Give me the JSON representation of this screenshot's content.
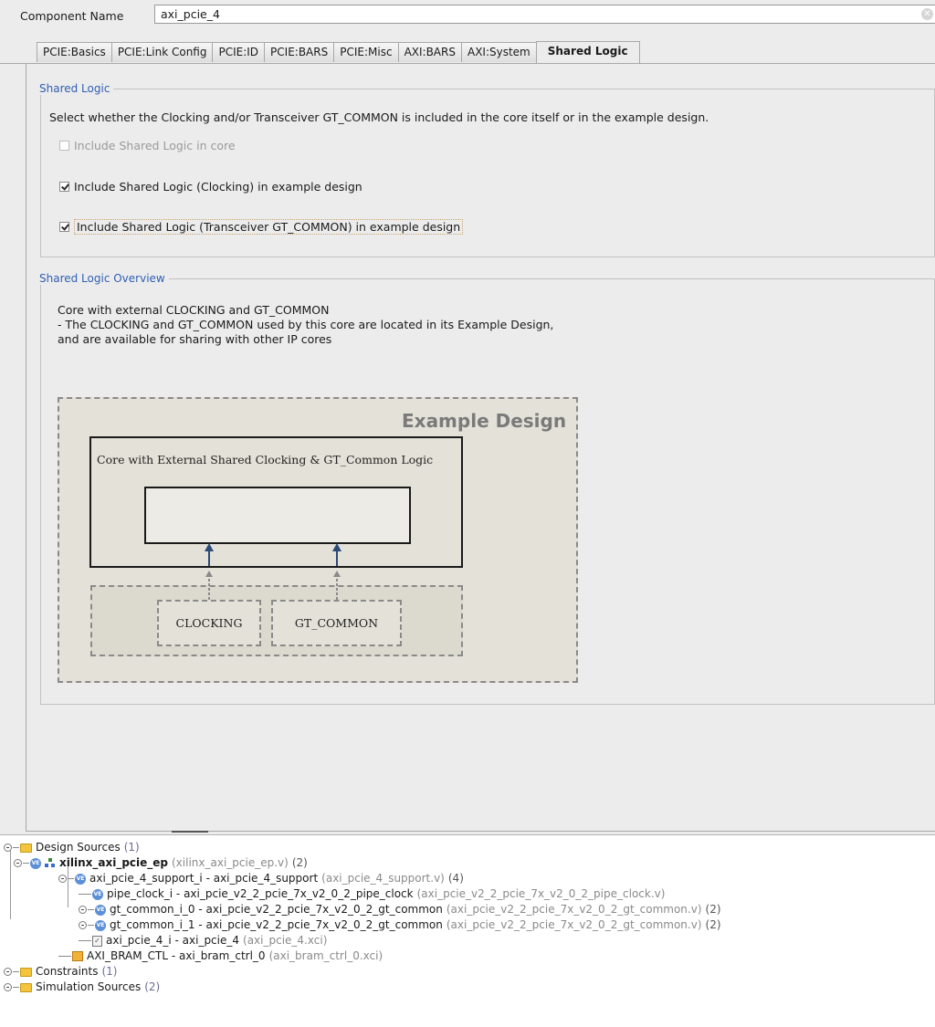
{
  "component": {
    "label": "Component Name",
    "value": "axi_pcie_4"
  },
  "tabs": [
    {
      "label": "PCIE:Basics"
    },
    {
      "label": "PCIE:Link Config"
    },
    {
      "label": "PCIE:ID"
    },
    {
      "label": "PCIE:BARS"
    },
    {
      "label": "PCIE:Misc"
    },
    {
      "label": "AXI:BARS"
    },
    {
      "label": "AXI:System"
    },
    {
      "label": "Shared Logic",
      "active": true
    }
  ],
  "shared_logic": {
    "title": "Shared Logic",
    "description": "Select whether the Clocking and/or Transceiver GT_COMMON is included in the core itself or in the example design.",
    "options": [
      {
        "label": "Include Shared Logic in core",
        "checked": false,
        "enabled": false
      },
      {
        "label": "Include Shared Logic (Clocking) in example design",
        "checked": true,
        "enabled": true
      },
      {
        "label": "Include Shared Logic (Transceiver GT_COMMON) in example design",
        "checked": true,
        "enabled": true
      }
    ]
  },
  "overview": {
    "title": "Shared Logic Overview",
    "line1": "Core with external CLOCKING and GT_COMMON",
    "line2": "- The CLOCKING and GT_COMMON used by this core are located in its Example Design,",
    "line3": "and are available for sharing with other IP cores",
    "diagram": {
      "example_title": "Example Design",
      "core_title": "Core with External Shared Clocking & GT_Common Logic",
      "clocking": "CLOCKING",
      "gt_common": "GT_COMMON"
    }
  },
  "tree": {
    "design_sources": {
      "label": "Design Sources",
      "count": "(1)"
    },
    "top": {
      "name": "xilinx_axi_pcie_ep",
      "file": "(xilinx_axi_pcie_ep.v)",
      "count": "(2)"
    },
    "support": {
      "name": "axi_pcie_4_support_i - axi_pcie_4_support",
      "file": "(axi_pcie_4_support.v)",
      "count": "(4)"
    },
    "pipe_clock": {
      "name": "pipe_clock_i - axi_pcie_v2_2_pcie_7x_v2_0_2_pipe_clock",
      "file": "(axi_pcie_v2_2_pcie_7x_v2_0_2_pipe_clock.v)"
    },
    "gt_common_0": {
      "name": "gt_common_i_0 - axi_pcie_v2_2_pcie_7x_v2_0_2_gt_common",
      "file": "(axi_pcie_v2_2_pcie_7x_v2_0_2_gt_common.v)",
      "count": "(2)"
    },
    "gt_common_1": {
      "name": "gt_common_i_1 - axi_pcie_v2_2_pcie_7x_v2_0_2_gt_common",
      "file": "(axi_pcie_v2_2_pcie_7x_v2_0_2_gt_common.v)",
      "count": "(2)"
    },
    "axi_pcie": {
      "name": "axi_pcie_4_i - axi_pcie_4",
      "file": "(axi_pcie_4.xci)"
    },
    "bram": {
      "name": "AXI_BRAM_CTL - axi_bram_ctrl_0",
      "file": "(axi_bram_ctrl_0.xci)"
    },
    "constraints": {
      "label": "Constraints",
      "count": "(1)"
    },
    "simulation": {
      "label": "Simulation Sources",
      "count": "(2)"
    }
  }
}
